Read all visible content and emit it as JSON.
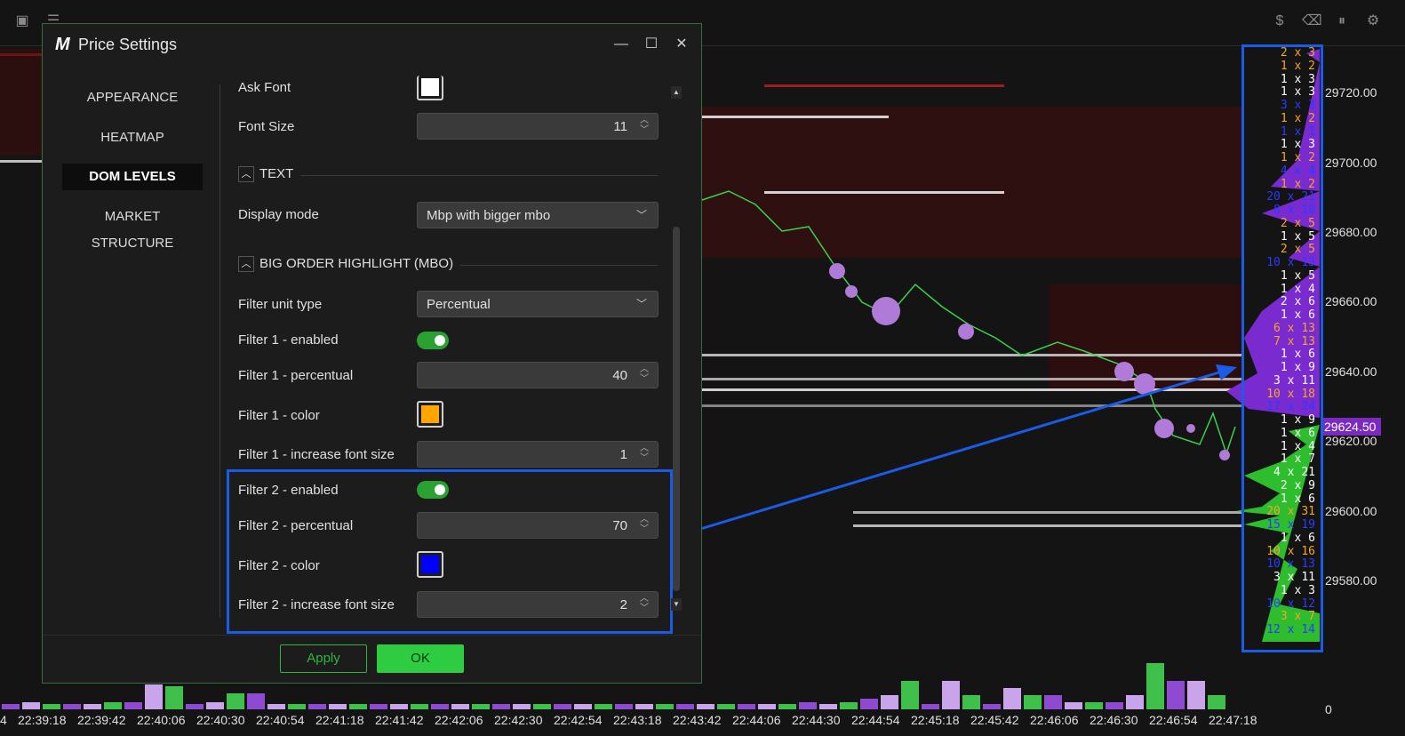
{
  "toolbar": {
    "left_icons": [
      "layout-icon",
      "menu-icon",
      "list-icon",
      "sliders-icon",
      "timer-icon",
      "chat-icon",
      "pencil-icon"
    ],
    "right_icons": [
      "dollar-icon",
      "eraser-icon",
      "pause-icon",
      "gear-icon"
    ]
  },
  "price_axis": {
    "labels": [
      "29720.00",
      "29700.00",
      "29680.00",
      "29660.00",
      "29640.00",
      "29620.00",
      "29600.00",
      "29580.00"
    ],
    "current_price": "29624.50",
    "bottom_label": "0"
  },
  "time_axis": {
    "first_partial": "4",
    "labels": [
      "22:39:18",
      "22:39:42",
      "22:40:06",
      "22:40:30",
      "22:40:54",
      "22:41:18",
      "22:41:42",
      "22:42:06",
      "22:42:30",
      "22:42:54",
      "22:43:18",
      "22:43:42",
      "22:44:06",
      "22:44:30",
      "22:44:54",
      "22:45:18",
      "22:45:42",
      "22:46:06",
      "22:46:30",
      "22:46:54",
      "22:47:18"
    ]
  },
  "dom_levels": [
    {
      "text": "2 x 3",
      "color": "#f5a623"
    },
    {
      "text": "1 x 2",
      "color": "#f5a623"
    },
    {
      "text": "1 x 3",
      "color": "#ffffff"
    },
    {
      "text": "1 x 3",
      "color": "#ffffff"
    },
    {
      "text": "3 x 3",
      "color": "#2a3bff"
    },
    {
      "text": "1 x 2",
      "color": "#f5a623"
    },
    {
      "text": "1 x 1",
      "color": "#2a3bff"
    },
    {
      "text": "1 x 3",
      "color": "#ffffff"
    },
    {
      "text": "1 x 2",
      "color": "#f5a623"
    },
    {
      "text": "4 x 4",
      "color": "#2a3bff"
    },
    {
      "text": "1 x 2",
      "color": "#f5a623"
    },
    {
      "text": "20 x 21",
      "color": "#2a3bff"
    },
    {
      "text": "8 x 10",
      "color": "#2a3bff"
    },
    {
      "text": "2 x 5",
      "color": "#f5a623"
    },
    {
      "text": "1 x 5",
      "color": "#ffffff"
    },
    {
      "text": "2 x 5",
      "color": "#f5a623"
    },
    {
      "text": "10 x 13",
      "color": "#2a3bff"
    },
    {
      "text": "1 x 5",
      "color": "#ffffff"
    },
    {
      "text": "1 x 4",
      "color": "#ffffff"
    },
    {
      "text": "2 x 6",
      "color": "#ffffff"
    },
    {
      "text": "1 x 6",
      "color": "#ffffff"
    },
    {
      "text": "6 x 13",
      "color": "#f5a623"
    },
    {
      "text": "7 x 13",
      "color": "#f5a623"
    },
    {
      "text": "1 x 6",
      "color": "#ffffff"
    },
    {
      "text": "1 x 9",
      "color": "#ffffff"
    },
    {
      "text": "3 x 11",
      "color": "#ffffff"
    },
    {
      "text": "10 x 18",
      "color": "#f5a623"
    },
    {
      "text": "17 x 24",
      "color": "#2a3bff"
    },
    {
      "text": "1 x 9",
      "color": "#ffffff"
    },
    {
      "text": "1 x 6",
      "color": "#ffffff"
    },
    {
      "text": "1 x 4",
      "color": "#ffffff"
    },
    {
      "text": "1 x 7",
      "color": "#ffffff"
    },
    {
      "text": "4 x 21",
      "color": "#ffffff"
    },
    {
      "text": "2 x 9",
      "color": "#ffffff"
    },
    {
      "text": "1 x 6",
      "color": "#ffffff"
    },
    {
      "text": "20 x 31",
      "color": "#f5a623"
    },
    {
      "text": "15 x 19",
      "color": "#2a3bff"
    },
    {
      "text": "1 x 6",
      "color": "#ffffff"
    },
    {
      "text": "10 x 16",
      "color": "#f5a623"
    },
    {
      "text": "10 x 13",
      "color": "#2a3bff"
    },
    {
      "text": "3 x 11",
      "color": "#ffffff"
    },
    {
      "text": "1 x 3",
      "color": "#ffffff"
    },
    {
      "text": "10 x 12",
      "color": "#2a3bff"
    },
    {
      "text": "3 x 7",
      "color": "#f5a623"
    },
    {
      "text": "12 x 14",
      "color": "#2a3bff"
    }
  ],
  "dialog": {
    "logo": "M",
    "title": "Price Settings",
    "window_buttons": {
      "minimize": "—",
      "maximize": "☐",
      "close": "✕"
    },
    "sidebar": {
      "items": [
        {
          "label": "APPEARANCE",
          "active": false
        },
        {
          "label": "HEATMAP",
          "active": false
        },
        {
          "label": "DOM LEVELS",
          "active": true
        },
        {
          "label": "MARKET STRUCTURE",
          "active": false
        }
      ]
    },
    "fields": {
      "ask_font_label": "Ask Font",
      "ask_font_color": "#ffffff",
      "font_size_label": "Font Size",
      "font_size_value": "11",
      "text_section": "TEXT",
      "display_mode_label": "Display mode",
      "display_mode_value": "Mbp with bigger mbo",
      "big_order_section": "BIG ORDER HIGHLIGHT (MBO)",
      "filter_unit_label": "Filter unit type",
      "filter_unit_value": "Percentual",
      "f1_enabled_label": "Filter 1 - enabled",
      "f1_enabled": true,
      "f1_pct_label": "Filter 1 - percentual",
      "f1_pct_value": "40",
      "f1_color_label": "Filter 1 - color",
      "f1_color": "#ffa500",
      "f1_font_label": "Filter 1 - increase font size",
      "f1_font_value": "1",
      "f2_enabled_label": "Filter 2 - enabled",
      "f2_enabled": true,
      "f2_pct_label": "Filter 2 - percentual",
      "f2_pct_value": "70",
      "f2_color_label": "Filter 2 - color",
      "f2_color": "#0000ff",
      "f2_font_label": "Filter 2 - increase font size",
      "f2_font_value": "2"
    },
    "buttons": {
      "apply": "Apply",
      "ok": "OK"
    }
  },
  "colors": {
    "accent_green": "#2ecc40",
    "annotation_blue": "#1a5be8",
    "current_price_bg": "#7a2bbf"
  }
}
